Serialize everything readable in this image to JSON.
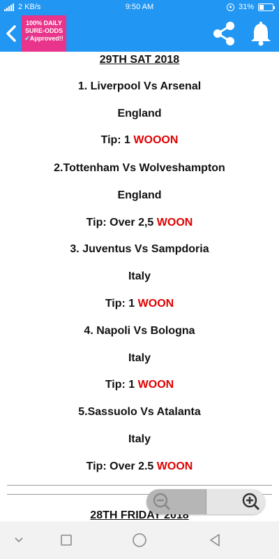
{
  "status_bar": {
    "network_speed": "2 KB/s",
    "time": "9:50 AM",
    "battery_percent": "31%",
    "battery_level": 0.31
  },
  "app_bar": {
    "badge_line1": "100% DAILY",
    "badge_line2": "SURE-ODDS",
    "badge_line3": "Approved!!",
    "colors": {
      "bar": "#2196f3",
      "badge": "#e8348a"
    }
  },
  "content": {
    "section1": {
      "date": "29TH SAT 2018",
      "matches": [
        {
          "title": "1. Liverpool Vs Arsenal",
          "country": "England",
          "tip": "Tip: 1",
          "result": "WOOON"
        },
        {
          "title": "2.Tottenham Vs Wolveshampton",
          "country": "England",
          "tip": "Tip: Over 2,5",
          "result": "WOON"
        },
        {
          "title": "3. Juventus Vs Sampdoria",
          "country": "Italy",
          "tip": "Tip: 1",
          "result": "WOON"
        },
        {
          "title": "4. Napoli Vs Bologna",
          "country": "Italy",
          "tip": "Tip: 1",
          "result": "WOON"
        },
        {
          "title": "5.Sassuolo Vs Atalanta",
          "country": "Italy",
          "tip": "Tip: Over 2.5",
          "result": "WOON"
        }
      ]
    },
    "section2": {
      "date": "28TH FRIDAY 2018"
    },
    "result_color": "#e00000"
  },
  "icons": {
    "back": "back-arrow-icon",
    "share": "share-icon",
    "bell": "bell-icon",
    "zoom_out": "zoom-out-icon",
    "zoom_in": "zoom-in-icon",
    "nav_down": "chevron-down-icon",
    "nav_recents": "square-icon",
    "nav_home": "circle-icon",
    "nav_back": "triangle-back-icon"
  }
}
